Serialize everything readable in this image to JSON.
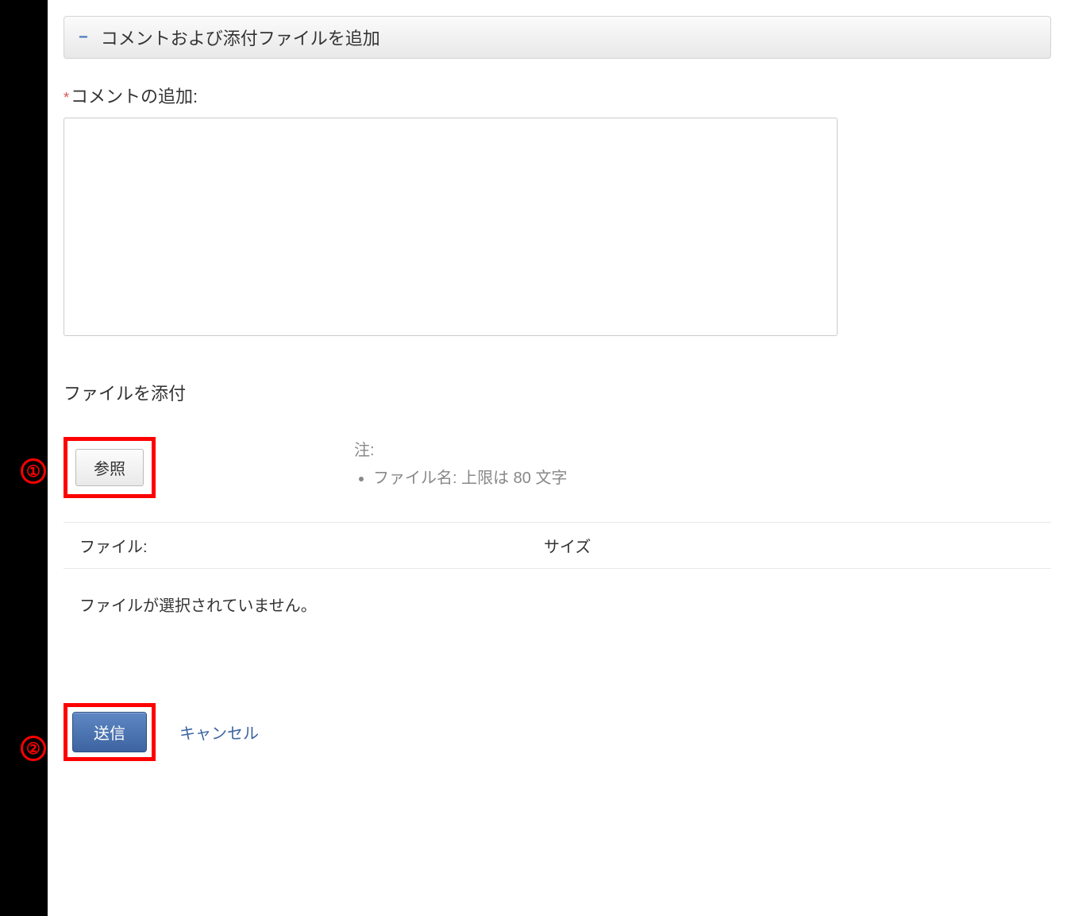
{
  "header": {
    "collapse_glyph": "−",
    "title": "コメントおよび添付ファイルを追加"
  },
  "comment": {
    "required_marker": "*",
    "label": "コメントの追加:"
  },
  "attachment": {
    "label": "ファイルを添付",
    "browse_label": "参照",
    "note_label": "注:",
    "note_item": "ファイル名: 上限は 80 文字"
  },
  "file_table": {
    "col_file": "ファイル:",
    "col_size": "サイズ",
    "empty_text": "ファイルが選択されていません。"
  },
  "actions": {
    "submit_label": "送信",
    "cancel_label": "キャンセル"
  },
  "annotations": {
    "one": "①",
    "two": "②"
  }
}
